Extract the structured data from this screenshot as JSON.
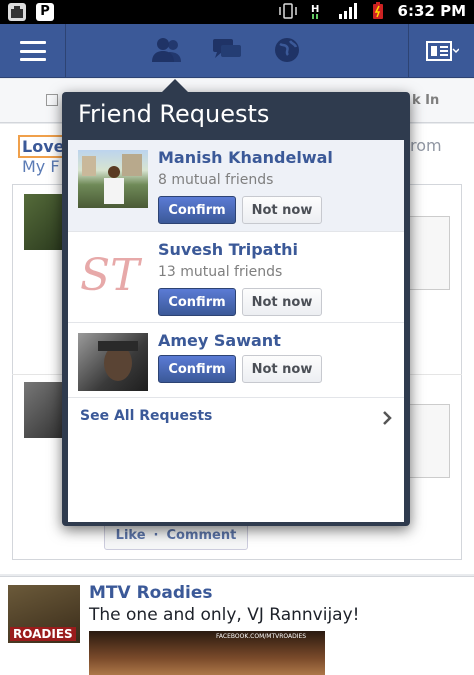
{
  "status_bar": {
    "left_icons": [
      "notification-icon",
      "p-app-icon"
    ],
    "p_app_letter": "P",
    "time": "6:32 PM",
    "network_label": "H"
  },
  "topbar": {
    "menu_icon": "hamburger-icon",
    "jewels": [
      "friend-requests-icon",
      "messages-icon",
      "notifications-globe-icon"
    ],
    "right_icon": "feed-list-icon",
    "bar_color": "#3b5998"
  },
  "background": {
    "subbar_text": "k In",
    "love_tag": "Love",
    "my_f": "My F",
    "from": "rom",
    "like": "Like",
    "dot": "·",
    "comment": "Comment"
  },
  "popover": {
    "title": "Friend Requests",
    "requests": [
      {
        "name": "Manish Khandelwal",
        "mutual": "8 mutual friends",
        "confirm": "Confirm",
        "not_now": "Not now"
      },
      {
        "name": "Suvesh Tripathi",
        "mutual": "13 mutual friends",
        "confirm": "Confirm",
        "not_now": "Not now",
        "photo_text": "ST"
      },
      {
        "name": "Amey Sawant",
        "mutual": "",
        "confirm": "Confirm",
        "not_now": "Not now"
      }
    ],
    "see_all": "See All Requests"
  },
  "post": {
    "page_name": "MTV Roadies",
    "text": "The one and only, VJ Rannvijay!",
    "avatar_text": "ROADIES",
    "image_caption": "FACEBOOK.COM/MTVROADIES"
  }
}
